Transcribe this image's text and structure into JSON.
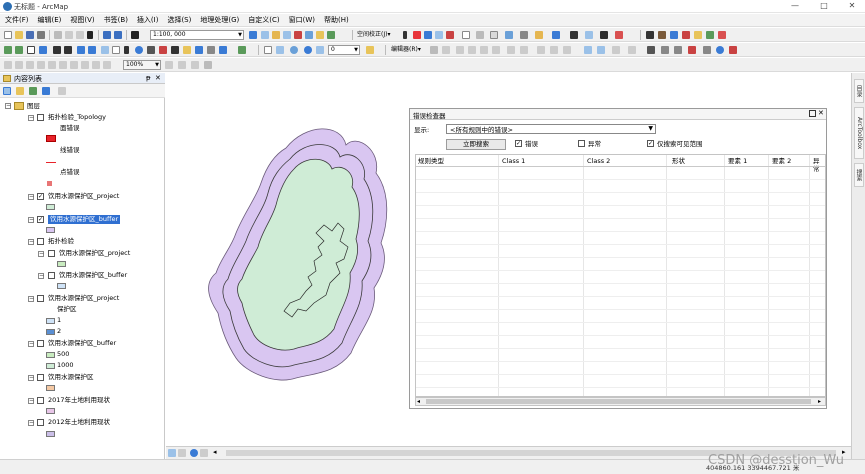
{
  "app": {
    "title": "无标题 - ArcMap",
    "min": "—",
    "max": "□",
    "close": "✕"
  },
  "menu": [
    "文件(F)",
    "编辑(E)",
    "视图(V)",
    "书签(B)",
    "插入(I)",
    "选择(S)",
    "地理处理(G)",
    "自定义(C)",
    "窗口(W)",
    "帮助(H)"
  ],
  "toolbar": {
    "scale": "1:100, 000",
    "georef_label": "空间校正(J)▾",
    "editor_label": "编辑器(R)▾",
    "field_value": "0",
    "zoom_pct": "100%"
  },
  "toc": {
    "title": "内容列表",
    "pin": "ᵽ",
    "close": "✕",
    "layers_group": "图层",
    "items": [
      {
        "label": "拓扑检验_Topology",
        "checked": false
      },
      {
        "label": "面错误"
      },
      {
        "label": "线错误"
      },
      {
        "label": "点错误"
      },
      {
        "label": "饮用水源保护区_project",
        "checked": true
      },
      {
        "label": "饮用水源保护区_buffer",
        "checked": true
      },
      {
        "label": "拓扑检验",
        "checked": false
      },
      {
        "label": "饮用水源保护区_project",
        "checked": false
      },
      {
        "label": "饮用水源保护区_buffer",
        "checked": false
      },
      {
        "label": "饮用水源保护区_project",
        "checked": false
      },
      {
        "label": "保护区"
      },
      {
        "label": "1"
      },
      {
        "label": "2"
      },
      {
        "label": "饮用水源保护区_buffer",
        "checked": false
      },
      {
        "label": "500"
      },
      {
        "label": "1000"
      },
      {
        "label": "饮用水源保护区",
        "checked": false
      },
      {
        "label": "2017年土地利用现状",
        "checked": false
      },
      {
        "label": "2012年土地利用现状",
        "checked": false
      }
    ],
    "colors": {
      "error_red": "#e8232a",
      "green_fill": "#cfecd6",
      "purple_fill": "#d9c6f1",
      "blue_fill": "#5a8fd3",
      "lightblue": "#cfe3f7",
      "lightgreen": "#c9ecc0",
      "orange": "#f5c9a4",
      "pink": "#e8c6e8",
      "lilac": "#cbbfe8"
    }
  },
  "error_inspector": {
    "title": "错误检查器",
    "show_label": "显示:",
    "show_value": "<所有规则中的错误>",
    "search_button": "立即搜索",
    "errors_label": "错误",
    "errors_checked": true,
    "exceptions_label": "异常",
    "exceptions_checked": false,
    "visible_extent_label": "仅搜索可见范围",
    "visible_extent_checked": true,
    "columns": [
      "规则类型",
      "Class 1",
      "Class 2",
      "形状",
      "要素 1",
      "要素 2",
      "异常"
    ]
  },
  "right_tabs": [
    "目录",
    "ArcToolbox",
    "搜索"
  ],
  "status": {
    "coords": "404860.161  3394467.721 米"
  },
  "watermark": "CSDN @desstion_Wu"
}
